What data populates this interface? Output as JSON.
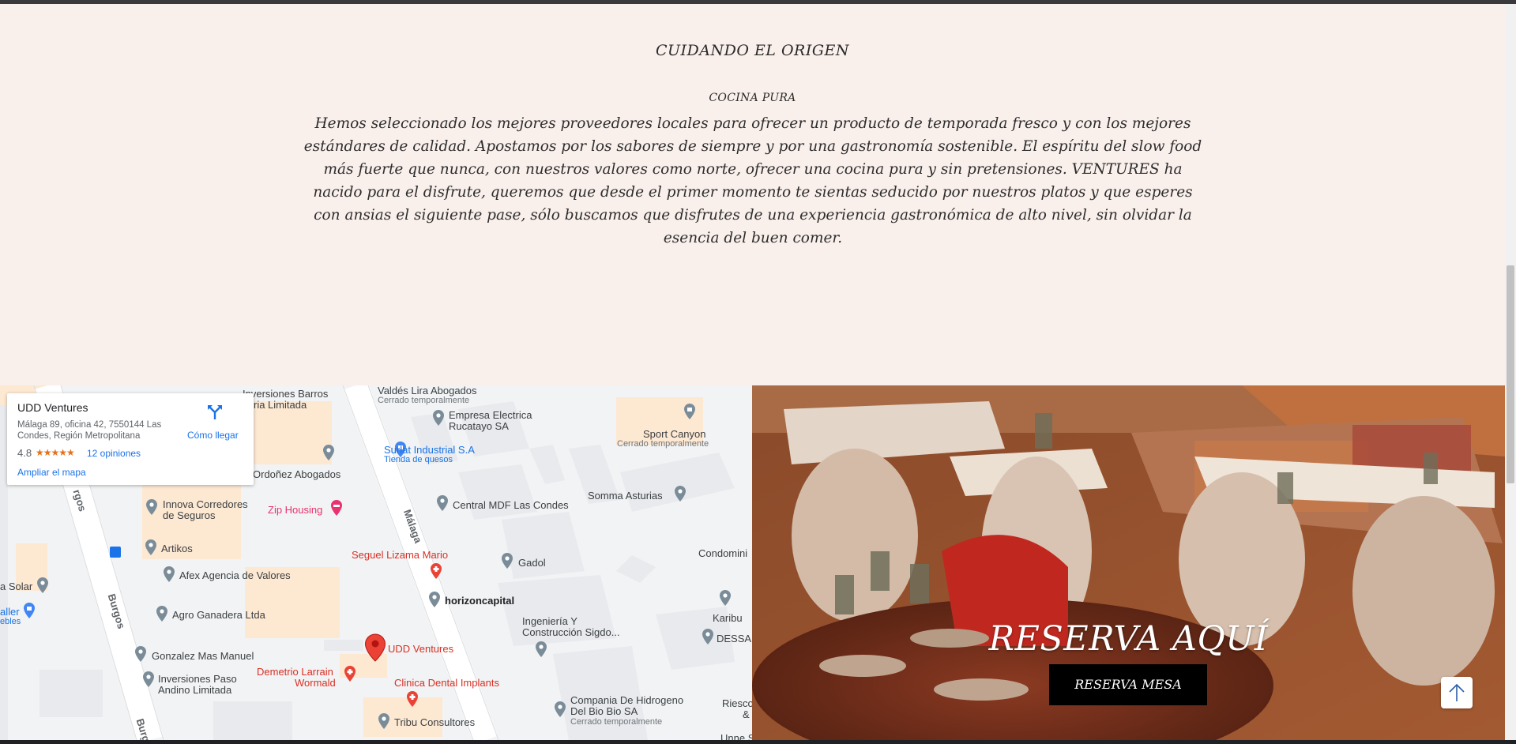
{
  "origin": {
    "title": "CUIDANDO EL ORIGEN",
    "subtitle": "COCINA PURA",
    "paragraph": "Hemos seleccionado los mejores proveedores locales para ofrecer un producto de temporada fresco y con los mejores estándares de calidad. Apostamos por los sabores de siempre y por una gastronomía sostenible. El espíritu del slow food más fuerte que nunca, con nuestros valores como norte, ofrecer una cocina pura y sin pretensiones. VENTURES ha nacido para el disfrute, queremos que desde el primer momento te sientas seducido por nuestros platos y que esperes con ansias el siguiente pase, sólo buscamos que disfrutes de una experiencia gastronómica de alto nivel, sin olvidar la esencia del buen comer."
  },
  "map": {
    "card": {
      "name": "UDD Ventures",
      "address": "Málaga 89, oficina 42, 7550144 Las Condes, Región Metropolitana",
      "rating": "4.8",
      "stars": "★★★★★",
      "reviews": "12 opiniones",
      "enlarge": "Ampliar el mapa",
      "directions": "Cómo llegar"
    },
    "streets": {
      "malaga": "Málaga",
      "burgos": "Burgos",
      "burgos_top": "rgos",
      "burgos_bottom": "Burg"
    },
    "places": {
      "inversiones_barros": "Inversiones Barros",
      "ria_limitada": "ria Limitada",
      "valdes": "Valdés Lira Abogados",
      "valdes_sub": "Cerrado temporalmente",
      "empresa": "Empresa Electrica",
      "empresa2": "Rucatayo SA",
      "sport": "Sport Canyon",
      "sport_sub": "Cerrado temporalmente",
      "surlat": "Surlat Industrial S.A",
      "surlat_sub": "Tienda de quesos",
      "ordonez": "Ordoñez Abogados",
      "innova": "Innova Corredores",
      "innova2": "de Seguros",
      "zip": "Zip Housing",
      "central": "Central MDF Las Condes",
      "somma": "Somma Asturias",
      "artikos": "Artikos",
      "seguel": "Seguel Lizama Mario",
      "gadol": "Gadol",
      "condominio": "Condomini",
      "afex": "Afex Agencia de Valores",
      "solar": "a Solar",
      "taller": "aller",
      "taller_sub": "ebles",
      "agro": "Agro Ganadera Ltda",
      "horizon": "horizoncapital",
      "karibu": "Karibu",
      "ingenieria": "Ingeniería Y",
      "ingenieria2": "Construcción Sigdo...",
      "dessa": "DESSA",
      "gonzalez": "Gonzalez Mas Manuel",
      "udd": "UDD Ventures",
      "inv_paso": "Inversiones Paso",
      "inv_paso2": "Andino Limitada",
      "demetrio": "Demetrio Larrain",
      "demetrio2": "Wormald",
      "clinica": "Clinica Dental Implants",
      "compania": "Compania De Hidrogeno",
      "compania2": "Del Bio Bio SA",
      "compania_sub": "Cerrado temporalmente",
      "riesco": "Riesco",
      "riesco2": "&",
      "tribu": "Tribu Consultores",
      "unne": "Unne S"
    }
  },
  "reserve": {
    "heading": "RESERVA AQUÍ",
    "button": "RESERVA MESA"
  },
  "colors": {
    "page_bg": "#f9efeb",
    "button_bg": "#000000",
    "map_pin": "#ea4335",
    "link": "#1a73e8"
  }
}
